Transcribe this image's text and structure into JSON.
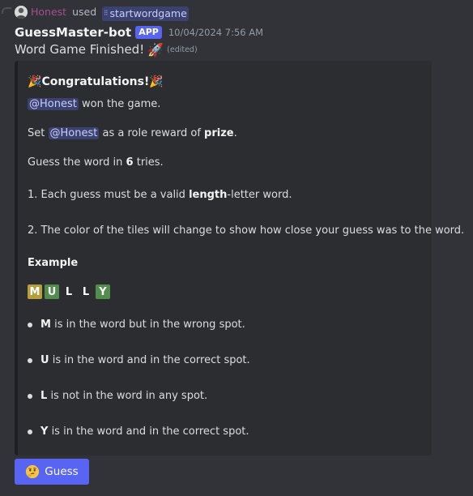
{
  "reply": {
    "user": "Honest",
    "used": "used",
    "command": "startwordgame",
    "command_icon": "slash-command-icon"
  },
  "header": {
    "bot_name": "GuessMaster-bot",
    "app_tag": "APP",
    "timestamp": "10/04/2024 7:56 AM"
  },
  "message": {
    "text": "Word Game Finished!",
    "emoji": "🚀",
    "edited": "(edited)"
  },
  "embed": {
    "title_emoji_left": "🎉",
    "title": "Congratulations!",
    "title_emoji_right": "🎉",
    "won_mention": "@Honest",
    "won_text": "won the game.",
    "role_prefix": "Set",
    "role_mention": "@Honest",
    "role_middle": "as a role reward of",
    "role_name": "prize",
    "role_suffix": ".",
    "guess_prefix": "Guess the word in",
    "guess_count": "6",
    "guess_suffix": "tries.",
    "rule1_prefix": "1. Each guess must be a valid",
    "rule1_bold": "length",
    "rule1_suffix": "-letter word.",
    "rule2": "2. The color of the tiles will change to show how close your guess was to the word.",
    "example_heading": "Example",
    "tiles": [
      {
        "letter": "M",
        "status": "wrong-spot",
        "color": "#b59f3b"
      },
      {
        "letter": "U",
        "status": "correct",
        "color": "#538d4e"
      },
      {
        "letter": "L",
        "status": "absent",
        "color": "#2b2d31"
      },
      {
        "letter": "L",
        "status": "absent",
        "color": "#2b2d31"
      },
      {
        "letter": "Y",
        "status": "correct",
        "color": "#538d4e"
      }
    ],
    "bullets": [
      {
        "letter": "M",
        "text": "is in the word but in the wrong spot."
      },
      {
        "letter": "U",
        "text": "is in the word and in the correct spot."
      },
      {
        "letter": "L",
        "text": "is not in the word in any spot."
      },
      {
        "letter": "Y",
        "text": "is in the word and in the correct spot."
      }
    ]
  },
  "button": {
    "label": "Guess",
    "icon": "thinking-face-icon",
    "color": "#5865f2"
  },
  "colors": {
    "background": "#313338",
    "embed_background": "#2b2d31",
    "mention_background": "#3c4270",
    "app_tag": "#5865f2"
  }
}
